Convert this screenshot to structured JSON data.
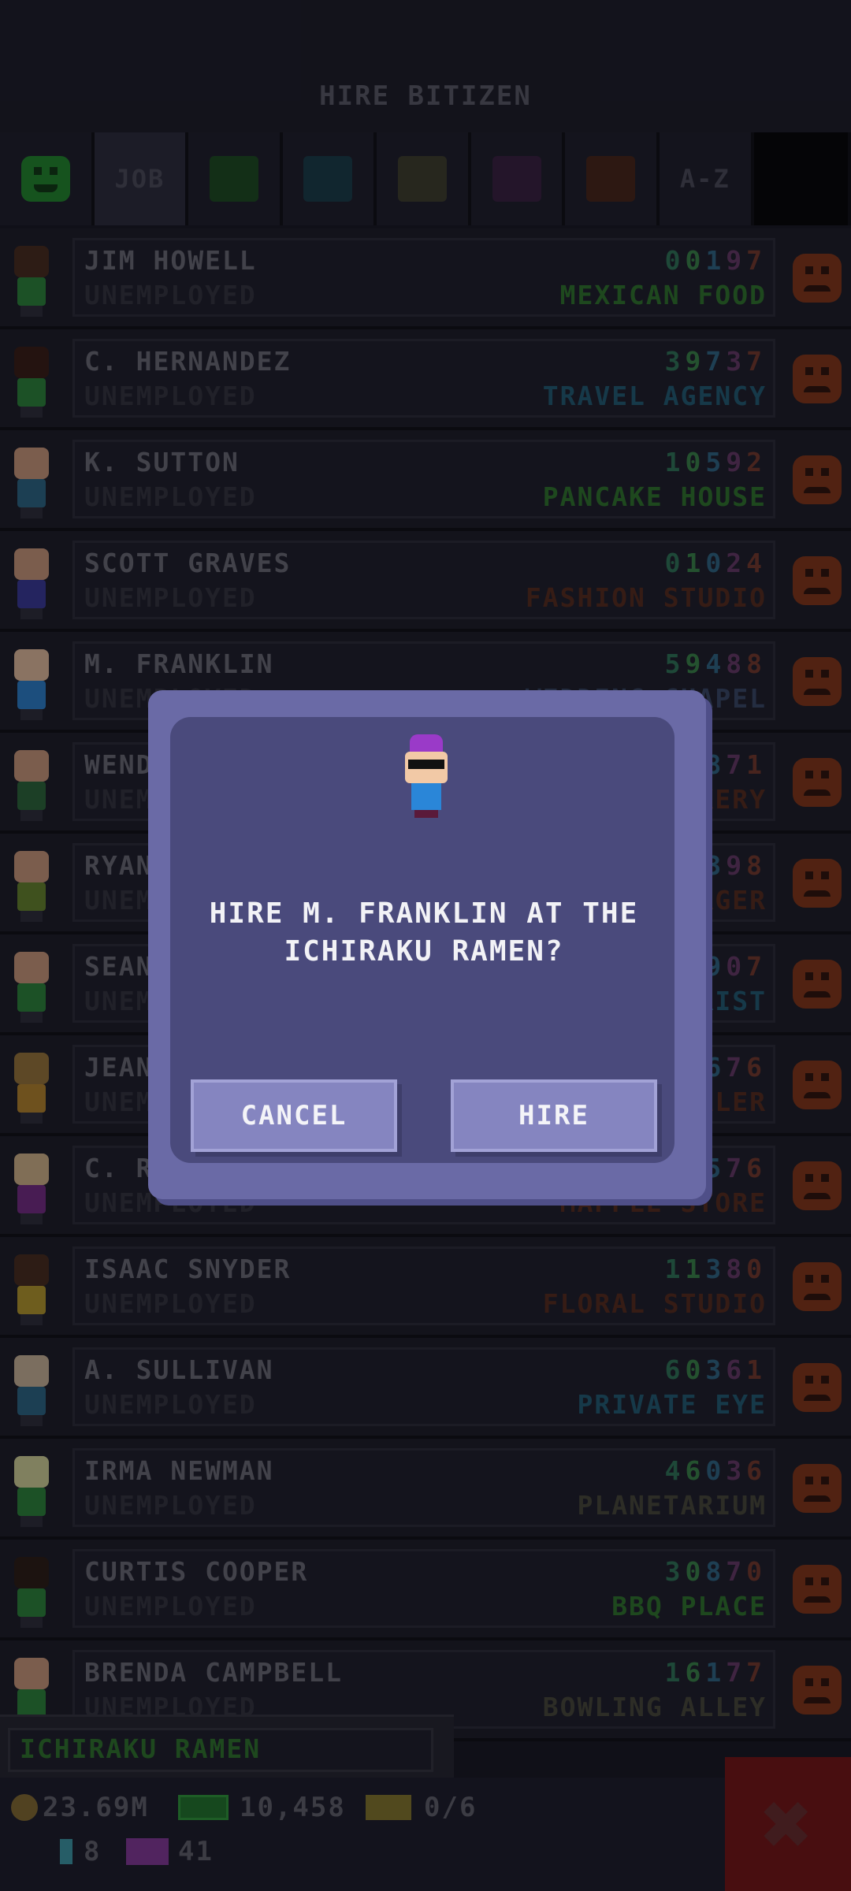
{
  "header": {
    "title": "HIRE BITIZEN"
  },
  "tabs": [
    {
      "type": "icon",
      "icon": "smiley-icon",
      "color": "#1f8f2a"
    },
    {
      "type": "text",
      "label": "JOB",
      "selected": true
    },
    {
      "type": "swatch",
      "color": "#1a4d1e"
    },
    {
      "type": "swatch",
      "color": "#163c4a"
    },
    {
      "type": "swatch",
      "color": "#3e3e2a"
    },
    {
      "type": "swatch",
      "color": "#3a1e40"
    },
    {
      "type": "swatch",
      "color": "#4a2414"
    },
    {
      "type": "text",
      "label": "A-Z"
    }
  ],
  "rows": [
    {
      "name": "JIM HOWELL",
      "status": "UNEMPLOYED",
      "digits": "00197",
      "business": "MEXICAN FOOD",
      "biz_color": "#2f7a2a",
      "head": "#4a2a1a",
      "body": "#2a8a3a"
    },
    {
      "name": "C. HERNANDEZ",
      "status": "UNEMPLOYED",
      "digits": "39737",
      "business": "TRAVEL AGENCY",
      "biz_color": "#1f5f78",
      "head": "#3a1a12",
      "body": "#2a8a3a"
    },
    {
      "name": "K. SUTTON",
      "status": "UNEMPLOYED",
      "digits": "10592",
      "business": "PANCAKE HOUSE",
      "biz_color": "#2f7a2a",
      "head": "#d8a080",
      "body": "#2a6a8a"
    },
    {
      "name": "SCOTT GRAVES",
      "status": "UNEMPLOYED",
      "digits": "01024",
      "business": "FASHION STUDIO",
      "biz_color": "#5a2a1a",
      "head": "#d8a080",
      "body": "#3a3aa0"
    },
    {
      "name": "M. FRANKLIN",
      "status": "UNEMPLOYED",
      "digits": "59488",
      "business": "WEDDING CHAPEL",
      "biz_color": "#3a4a6a",
      "head": "#f2c9a6",
      "body": "#2a86d8"
    },
    {
      "name": "WENDY HALE",
      "status": "UNEMPLOYED",
      "digits": "20871",
      "business": "BAKERY",
      "biz_color": "#5a2a1a",
      "head": "#d8a080",
      "body": "#2a6a3a"
    },
    {
      "name": "RYAN FORD",
      "status": "UNEMPLOYED",
      "digits": "44398",
      "business": "BURGER",
      "biz_color": "#5a2a1a",
      "head": "#d8a080",
      "body": "#6a8a2a"
    },
    {
      "name": "SEAN REED",
      "status": "UNEMPLOYED",
      "digits": "12907",
      "business": "FLORIST",
      "biz_color": "#1f5f78",
      "head": "#d8a080",
      "body": "#2a8a3a"
    },
    {
      "name": "JEAN HOLT",
      "status": "UNEMPLOYED",
      "digits": "35676",
      "business": "CAR DEALER",
      "biz_color": "#5a2a1a",
      "head": "#a07a3a",
      "body": "#c08a2a"
    },
    {
      "name": "C. ROSS",
      "status": "UNEMPLOYED",
      "digits": "47576",
      "business": "MAPPLE STORE",
      "biz_color": "#5a2a1a",
      "head": "#e0c090",
      "body": "#7a2a8a"
    },
    {
      "name": "ISAAC SNYDER",
      "status": "UNEMPLOYED",
      "digits": "11380",
      "business": "FLORAL STUDIO",
      "biz_color": "#5a2a1a",
      "head": "#4a2a1a",
      "body": "#c0a02a"
    },
    {
      "name": "A. SULLIVAN",
      "status": "UNEMPLOYED",
      "digits": "60361",
      "business": "PRIVATE EYE",
      "biz_color": "#1f5f78",
      "head": "#d8c0a0",
      "body": "#2a6a8a"
    },
    {
      "name": "IRMA NEWMAN",
      "status": "UNEMPLOYED",
      "digits": "46036",
      "business": "PLANETARIUM",
      "biz_color": "#4a4a3a",
      "head": "#e0e0a0",
      "body": "#2a8a3a"
    },
    {
      "name": "CURTIS COOPER",
      "status": "UNEMPLOYED",
      "digits": "30870",
      "business": "BBQ PLACE",
      "biz_color": "#2f7a2a",
      "head": "#2a1a12",
      "body": "#2a8a3a"
    },
    {
      "name": "BRENDA CAMPBELL",
      "status": "UNEMPLOYED",
      "digits": "16177",
      "business": "BOWLING ALLEY",
      "biz_color": "#4a4a3a",
      "head": "#d8a080",
      "body": "#2a8a3a"
    }
  ],
  "digit_colors": [
    "#2f7a5a",
    "#3a8a4a",
    "#2f6a8a",
    "#6a3a6a",
    "#7a3a2a"
  ],
  "floor": {
    "label": "ICHIRAKU RAMEN"
  },
  "stats": {
    "coins": "23.69M",
    "cash": "10,458",
    "tickets": "0/6",
    "bux": "8",
    "vip": "41"
  },
  "dialog": {
    "prompt": "HIRE M. FRANKLIN AT THE ICHIRAKU RAMEN?",
    "cancel_label": "CANCEL",
    "hire_label": "HIRE"
  },
  "close_icon": "✖"
}
